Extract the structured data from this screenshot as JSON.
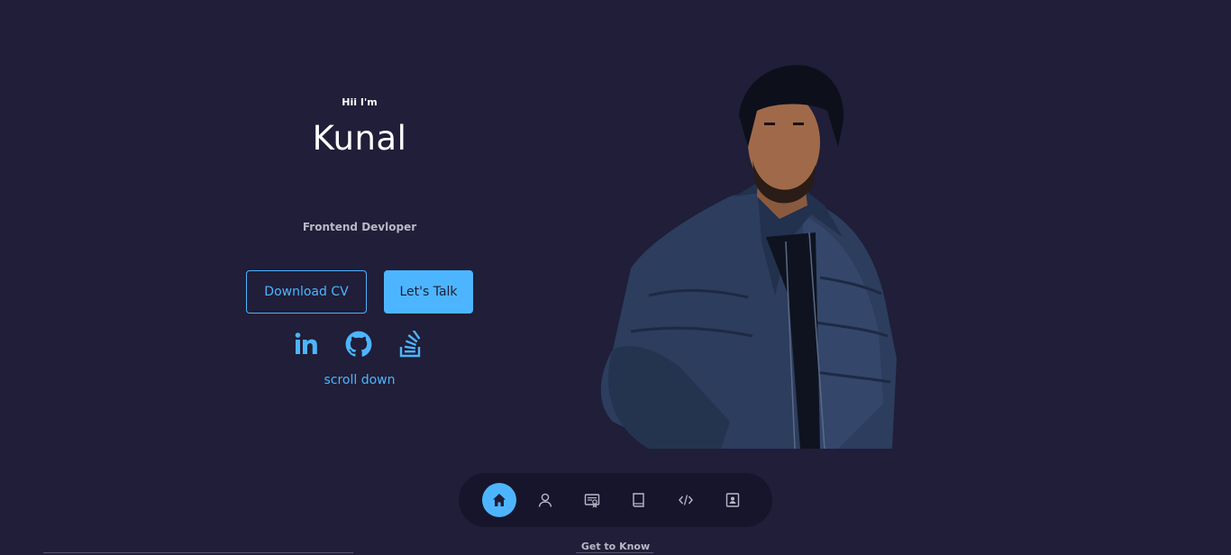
{
  "hero": {
    "greeting": "Hii I'm",
    "name": "Kunal",
    "role": "Frontend Devloper",
    "download_cv_label": "Download CV",
    "lets_talk_label": "Let's Talk",
    "scroll_down_label": "scroll down"
  },
  "socials": [
    {
      "icon": "linkedin-icon"
    },
    {
      "icon": "github-icon"
    },
    {
      "icon": "stackoverflow-icon"
    }
  ],
  "nav": {
    "items": [
      {
        "icon": "home-icon",
        "active": true
      },
      {
        "icon": "user-icon",
        "active": false
      },
      {
        "icon": "certificate-icon",
        "active": false
      },
      {
        "icon": "book-icon",
        "active": false
      },
      {
        "icon": "code-icon",
        "active": false
      },
      {
        "icon": "contact-card-icon",
        "active": false
      }
    ]
  },
  "next_section_label": "Get to Know",
  "colors": {
    "background": "#201e38",
    "accent": "#4db5ff",
    "nav_background": "#17152b",
    "muted_text": "#b9b8c7"
  }
}
